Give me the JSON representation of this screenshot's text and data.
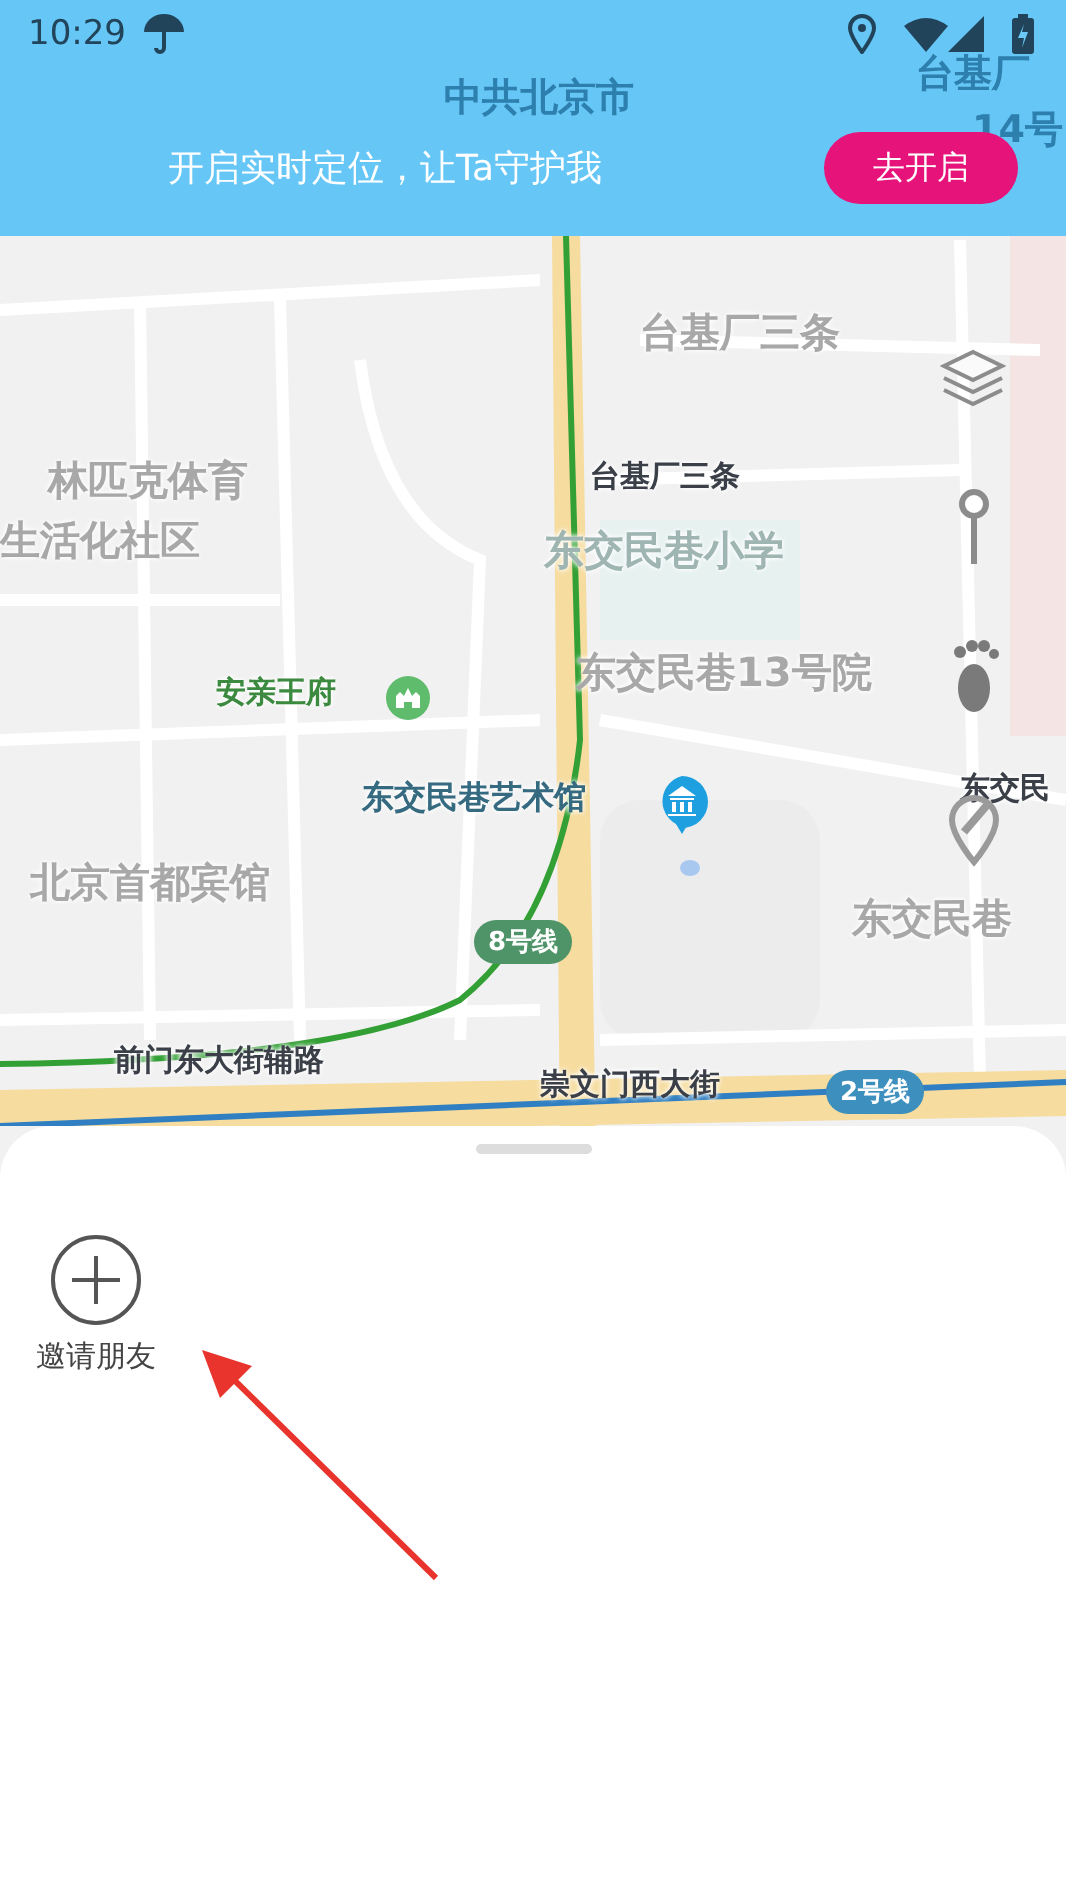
{
  "status_bar": {
    "time": "10:29"
  },
  "banner": {
    "message": "开启实时定位，让Ta守护我",
    "button": "去开启",
    "map_labels": [
      {
        "text": "中共北京市"
      },
      {
        "text": "台基厂"
      },
      {
        "text": "14号"
      }
    ]
  },
  "map": {
    "labels": [
      {
        "text": "台基厂三条",
        "kind": "area"
      },
      {
        "text": "林匹克体育",
        "kind": "area"
      },
      {
        "text": "生活化社区",
        "kind": "area"
      },
      {
        "text": "台基厂三条",
        "kind": "street"
      },
      {
        "text": "东交民巷小学",
        "kind": "school"
      },
      {
        "text": "东交民巷13号院",
        "kind": "area"
      },
      {
        "text": "安亲王府",
        "kind": "landmark"
      },
      {
        "text": "东交民巷艺术馆",
        "kind": "museum"
      },
      {
        "text": "北京首都宾馆",
        "kind": "area"
      },
      {
        "text": "东交民",
        "kind": "street"
      },
      {
        "text": "东交民巷",
        "kind": "area"
      },
      {
        "text": "前门东大街辅路",
        "kind": "street"
      },
      {
        "text": "崇文门西大街",
        "kind": "street"
      }
    ],
    "metro_badges": [
      {
        "text": "8号线",
        "color": "#4f9468"
      },
      {
        "text": "2号线",
        "color": "#3d8fbe"
      }
    ]
  },
  "sheet": {
    "actions": [
      {
        "label": "邀请朋友"
      }
    ]
  }
}
